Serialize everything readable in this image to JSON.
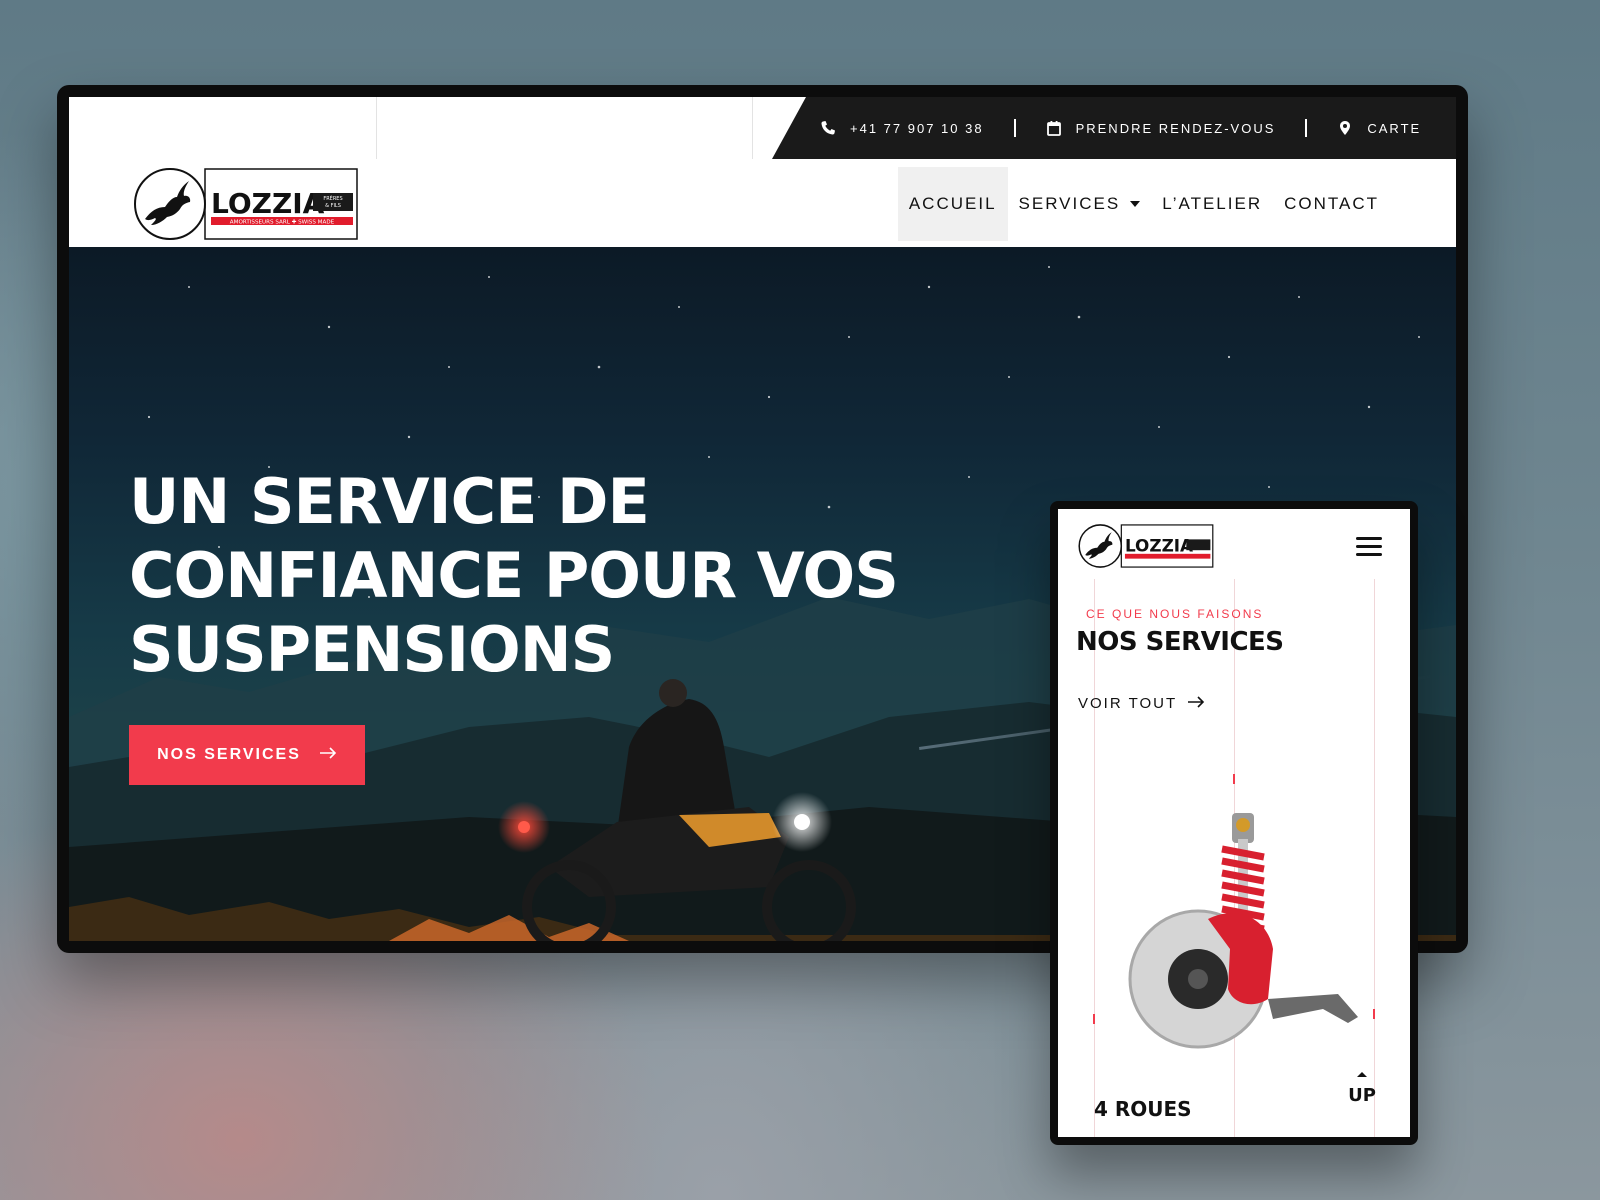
{
  "topbar": {
    "phone": "+41 77 907 10 38",
    "appointment": "PRENDRE RENDEZ-VOUS",
    "map": "CARTE"
  },
  "logo": {
    "name": "LOZZIA",
    "tagline": "FRÈRES & FILS",
    "subline": "AMORTISSEURS SARL ✚ SWISS MADE"
  },
  "nav": {
    "items": [
      {
        "label": "ACCUEIL",
        "active": true
      },
      {
        "label": "SERVICES",
        "has_dropdown": true
      },
      {
        "label": "L’ATELIER"
      },
      {
        "label": "CONTACT"
      }
    ]
  },
  "hero": {
    "title_lines": [
      "UN SERVICE DE",
      "CONFIANCE POUR VOS",
      "SUSPENSIONS"
    ],
    "cta_label": "NOS SERVICES"
  },
  "mobile": {
    "eyebrow": "CE QUE NOUS FAISONS",
    "title": "NOS SERVICES",
    "link_label": "VOIR TOUT",
    "card_title": "4 ROUES",
    "up_label": "UP"
  },
  "colors": {
    "accent": "#f23b4c",
    "dark": "#1a1a1a",
    "text": "#111111"
  },
  "icons": {
    "phone": "phone-icon",
    "calendar": "calendar-icon",
    "map": "map-pin-icon",
    "arrow": "arrow-right-icon",
    "menu": "hamburger-icon"
  }
}
